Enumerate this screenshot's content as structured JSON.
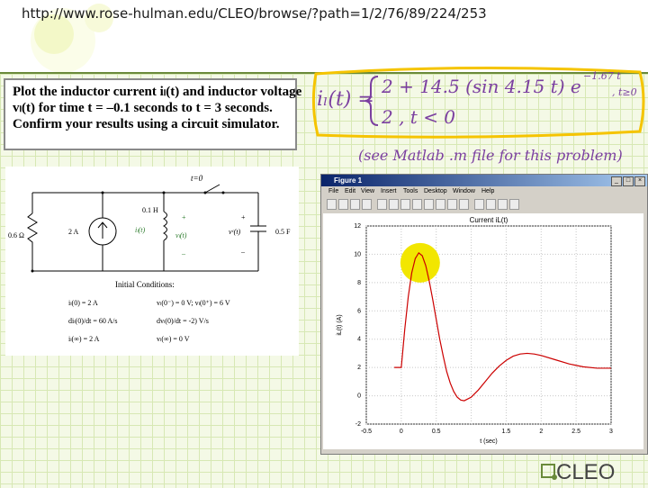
{
  "url": "http://www.rose-hulman.edu/CLEO/browse/?path=1/2/76/89/224/253",
  "problem": {
    "line1": "Plot the inductor current iₗ(t) and inductor voltage",
    "line2": "vₗ(t) for time t = –0.1 seconds to t = 3 seconds.",
    "line3": "Confirm your results using a circuit simulator."
  },
  "circuit": {
    "switch_label": "t=0",
    "inductor_value": "0.1 H",
    "resistor_value": "0.6 Ω",
    "source_value": "2 A",
    "capacitor_value": "0.5 F",
    "il_label": "iₗ(t)",
    "vl_label": "vₗ(t)",
    "vc_label": "vᶜ(t)",
    "plus": "+",
    "minus": "–",
    "conditions_title": "Initial Conditions:",
    "c1a": "iₗ(0) = 2 A",
    "c1b": "vₗ(0⁻) = 0 V; vₗ(0⁺) = 6 V",
    "c2a": "diₗ(0)/dt = 60 A/s",
    "c2b": "dvₗ(0)/dt = -2) V/s",
    "c3a": "iₗ(∞) = 2 A",
    "c3b": "vₗ(∞) = 0 V"
  },
  "handwritten": {
    "eq_lhs": "iₗ(t) =",
    "eq_case1": "2 + 14.5 (sin 4.15 t) e",
    "eq_exp": "−1.67 t",
    "eq_cond1": ", t≥0",
    "eq_case2": "2        ,  t < 0",
    "note": "(see Matlab .m file for this problem)"
  },
  "figure": {
    "window_title": "Figure 1",
    "menus": [
      "File",
      "Edit",
      "View",
      "Insert",
      "Tools",
      "Desktop",
      "Window",
      "Help"
    ],
    "window_buttons": [
      "_",
      "□",
      "×"
    ],
    "tool_icons": [
      "new-icon",
      "open-icon",
      "save-icon",
      "print-icon",
      "arrow-icon",
      "zoom-in-icon",
      "zoom-out-icon",
      "pan-icon",
      "rotate-icon",
      "datacursor-icon",
      "brush-icon",
      "link-icon",
      "colorbar-icon",
      "legend-icon",
      "plot-tools-icon",
      "dock-icon"
    ]
  },
  "chart_data": {
    "type": "line",
    "title": "Current iL(t)",
    "xlabel": "t (sec)",
    "ylabel": "iL(t) (A)",
    "xlim": [
      -0.5,
      3
    ],
    "ylim": [
      -2,
      12
    ],
    "xticks": [
      "-0.5",
      "0",
      "0.5",
      "",
      "1.5",
      "2",
      "2.5",
      "3"
    ],
    "xtick_values": [
      -0.5,
      0,
      0.5,
      1,
      1.5,
      2,
      2.5,
      3
    ],
    "yticks": [
      "-2",
      "0",
      "2",
      "4",
      "6",
      "8",
      "10",
      "12"
    ],
    "ytick_values": [
      -2,
      0,
      2,
      4,
      6,
      8,
      10,
      12
    ],
    "grid": true,
    "series": [
      {
        "color": "#cc0000",
        "x": [
          -0.1,
          0,
          0.05,
          0.1,
          0.15,
          0.2,
          0.25,
          0.3,
          0.35,
          0.4,
          0.45,
          0.5,
          0.55,
          0.6,
          0.65,
          0.7,
          0.75,
          0.8,
          0.85,
          0.9,
          1.0,
          1.1,
          1.2,
          1.3,
          1.4,
          1.5,
          1.6,
          1.7,
          1.8,
          1.9,
          2.0,
          2.2,
          2.4,
          2.6,
          2.8,
          3.0
        ],
        "y": [
          2,
          2,
          4.7,
          7.0,
          8.7,
          9.7,
          10.1,
          9.9,
          9.2,
          8.1,
          6.8,
          5.4,
          4.0,
          2.8,
          1.7,
          0.9,
          0.3,
          -0.1,
          -0.3,
          -0.35,
          -0.1,
          0.4,
          1.0,
          1.6,
          2.1,
          2.5,
          2.8,
          2.95,
          3.0,
          2.95,
          2.85,
          2.55,
          2.25,
          2.05,
          1.95,
          1.95
        ]
      }
    ],
    "highlight_color": "#f2e600"
  },
  "logo": {
    "text": "CLEO"
  }
}
